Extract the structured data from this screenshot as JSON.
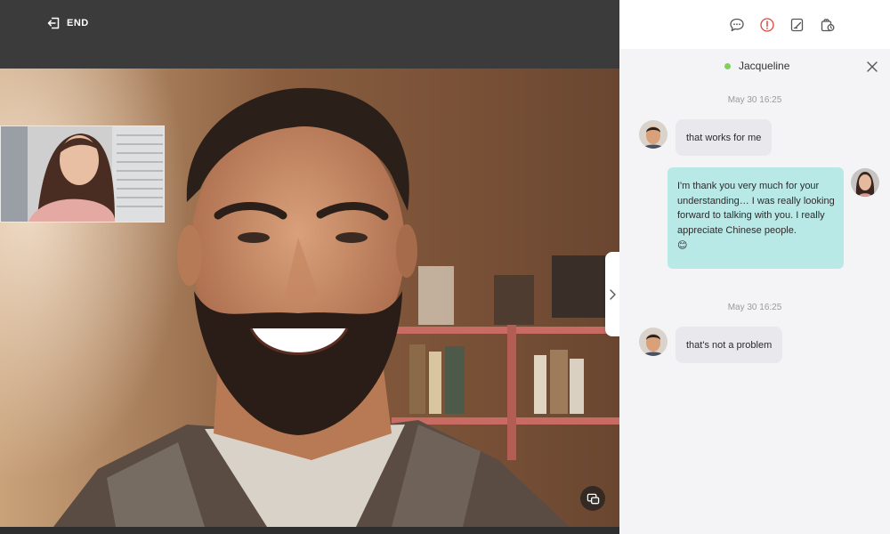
{
  "video": {
    "end_label": "END"
  },
  "toolbar": {
    "icons": [
      "chat-bubble-icon",
      "info-icon",
      "edit-note-icon",
      "gift-icon"
    ],
    "active_color": "#e0443a"
  },
  "chat": {
    "contact_name": "Jacqueline",
    "online_color": "#7fd15a",
    "messages": [
      {
        "type": "timestamp",
        "text": "May 30 16:25"
      },
      {
        "type": "incoming",
        "text": "that works for me"
      },
      {
        "type": "outgoing",
        "text": "I'm thank you very much for your understanding… I was really looking forward to talking with you. I really appreciate Chinese people.",
        "emoji": "😊"
      },
      {
        "type": "timestamp",
        "text": "May 30 16:25"
      },
      {
        "type": "incoming",
        "text": "that's not a problem"
      }
    ]
  },
  "colors": {
    "outgoing_bubble": "#b8e9e7",
    "incoming_bubble": "#e9e9ed",
    "panel_background": "#f4f4f6",
    "video_bar": "#3b3b3b"
  }
}
